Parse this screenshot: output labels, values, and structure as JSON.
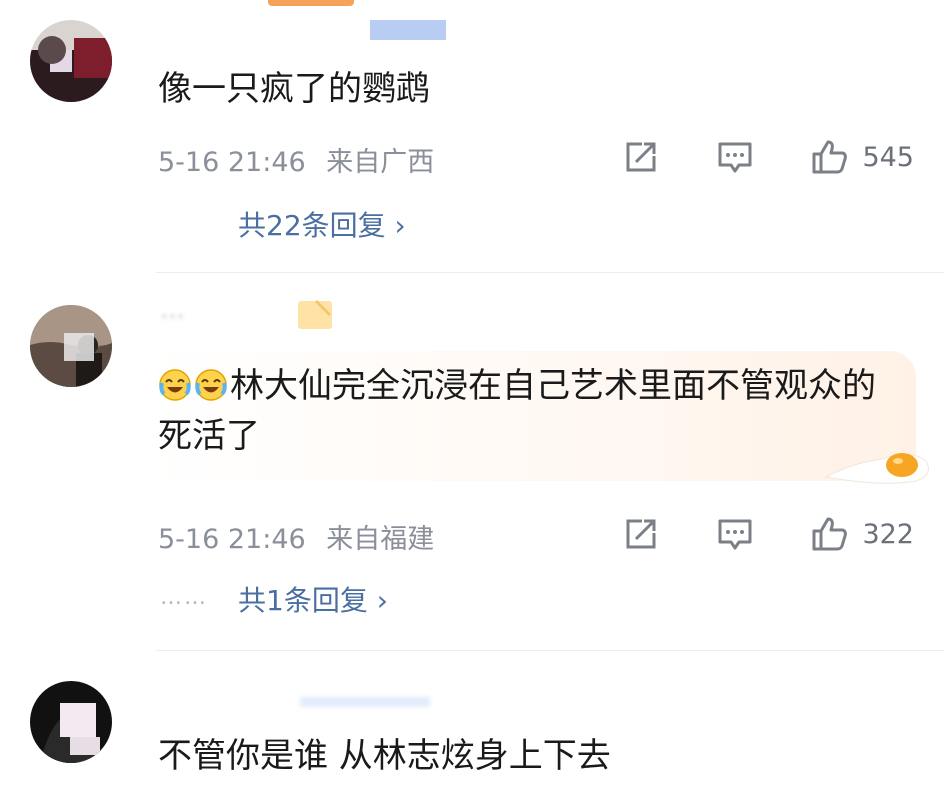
{
  "comments": [
    {
      "text": "像一只疯了的鹦鹉",
      "time": "5-16 21:46",
      "location": "来自广西",
      "likes": "545",
      "replies": "共22条回复 ›"
    },
    {
      "username": "...",
      "text": "林大仙完全沉浸在自己艺术里面不管观众的死活了",
      "time": "5-16 21:46",
      "location": "来自福建",
      "likes": "322",
      "dots": "……",
      "replies": "共1条回复 ›"
    },
    {
      "text": "不管你是谁 从林志炫身上下去"
    }
  ],
  "icons": {
    "share": "share-icon",
    "comment": "comment-icon",
    "like": "like-icon",
    "laugh_cry": "laugh-cry-emoji-icon"
  },
  "colors": {
    "link": "#4a6fa0",
    "meta": "#8a8f99"
  }
}
